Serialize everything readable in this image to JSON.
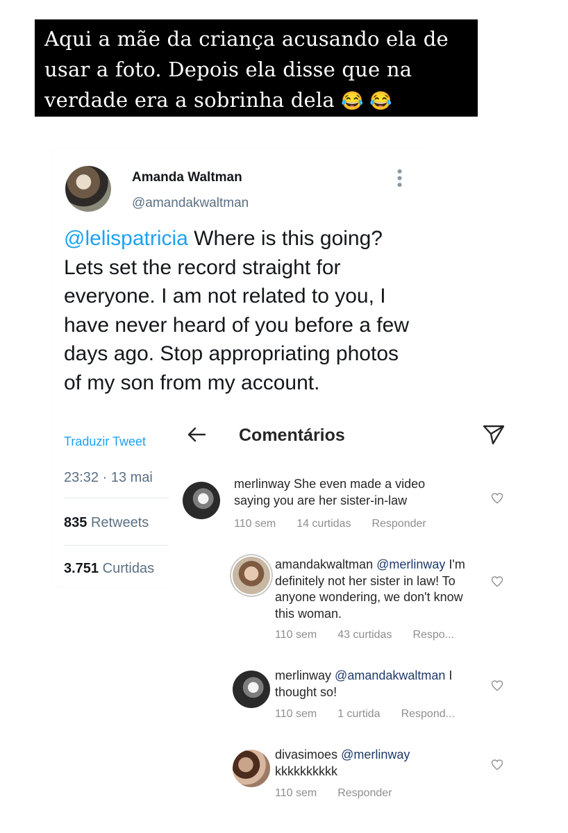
{
  "caption": {
    "text": "Aqui a mãe da criança acusando ela de usar a foto. Depois ela disse que na verdade era a sobrinha dela",
    "emojis": "😂 😂"
  },
  "tweet": {
    "name": "Amanda Waltman",
    "handle": "@amandakwaltman",
    "mention": "@lelispatricia",
    "text": " Where is this going? Lets set the record straight for everyone. I am not related to you, I have never heard of you before a few days ago. Stop appropriating photos of my son from my account.",
    "translate_label": "Traduzir Tweet",
    "timestamp": "23:32 · 13 mai ",
    "retweets_count": "835",
    "retweets_label": "Retweets",
    "likes_count": "3.751",
    "likes_label": "Curtidas",
    "colors": {
      "link": "#1da1f2",
      "meta": "#5b7083"
    }
  },
  "instagram": {
    "title": "Comentários",
    "comments": [
      {
        "user": "merlinway",
        "mention": "",
        "text": "She even made a video saying you are her sister-in-law",
        "time": "110 sem",
        "likes": "14 curtidas",
        "reply": "Responder"
      },
      {
        "user": "amandakwaltman",
        "mention": "@merlinway",
        "text": "I'm definitely not her sister in law! To anyone wondering, we don't know this woman.",
        "time": "110 sem",
        "likes": "43 curtidas",
        "reply": "Respo..."
      },
      {
        "user": "merlinway",
        "mention": "@amandakwaltman",
        "text": "I thought so!",
        "time": "110 sem",
        "likes": "1 curtida",
        "reply": "Respond..."
      },
      {
        "user": "divasimoes",
        "mention": "@merlinway",
        "text": "kkkkkkkkkk",
        "time": "110 sem",
        "likes": "",
        "reply": "Responder"
      }
    ],
    "icons": [
      "back-arrow-icon",
      "send-icon",
      "heart-icon"
    ]
  }
}
